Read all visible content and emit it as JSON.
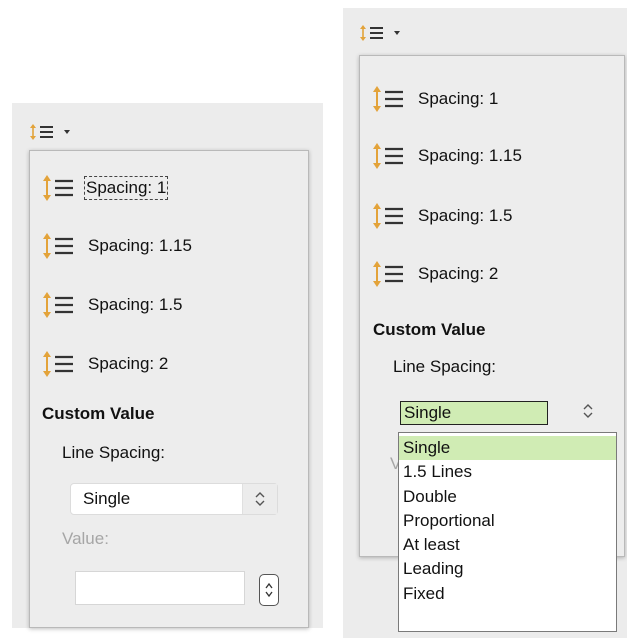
{
  "left": {
    "toolbar_button": "line-spacing-button",
    "items": [
      {
        "label": "Spacing: 1"
      },
      {
        "label": "Spacing: 1.15"
      },
      {
        "label": "Spacing: 1.5"
      },
      {
        "label": "Spacing: 2"
      }
    ],
    "custom_heading": "Custom Value",
    "line_spacing_label": "Line Spacing:",
    "line_spacing_value": "Single",
    "value_label": "Value:",
    "value_input": ""
  },
  "right": {
    "items": [
      {
        "label": "Spacing: 1"
      },
      {
        "label": "Spacing: 1.15"
      },
      {
        "label": "Spacing: 1.5"
      },
      {
        "label": "Spacing: 2"
      }
    ],
    "custom_heading": "Custom Value",
    "line_spacing_label": "Line Spacing:",
    "line_spacing_value": "Single",
    "options": [
      "Single",
      "1.5 Lines",
      "Double",
      "Proportional",
      "At least",
      "Leading",
      "Fixed"
    ],
    "selected_option": "Single"
  },
  "colors": {
    "icon_arrow": "#e3a33a",
    "icon_lines": "#333333",
    "selected_bg": "#d0ecb4",
    "disabled_text": "#a6a6a6"
  }
}
